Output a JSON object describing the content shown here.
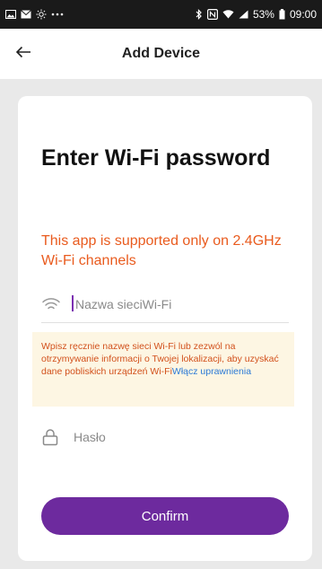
{
  "status_bar": {
    "battery_percent": "53%",
    "time": "09:00",
    "notification_icons": [
      "image-icon",
      "mail-icon",
      "sun-icon",
      "more-icon"
    ],
    "system_icons": [
      "bluetooth-icon",
      "nfc-icon",
      "wifi-icon",
      "signal-icon",
      "battery-icon"
    ]
  },
  "header": {
    "title": "Add Device",
    "back_icon": "arrow-left-icon"
  },
  "card": {
    "heading": "Enter Wi-Fi password",
    "warning": "This app is supported only on 2.4GHz Wi-Fi channels",
    "ssid": {
      "icon": "wifi-icon",
      "placeholder": "Nazwa sieciWi-Fi",
      "value": ""
    },
    "hint": {
      "text": "Wpisz ręcznie nazwę sieci Wi-Fi lub zezwól na otrzymywanie informacji o Twojej lokalizacji, aby uzyskać dane pobliskich urządzeń Wi-Fi",
      "link_text": "Włącz uprawnienia"
    },
    "password": {
      "icon": "lock-icon",
      "placeholder": "Hasło",
      "value": ""
    },
    "confirm_label": "Confirm"
  },
  "colors": {
    "accent": "#6d2a9e",
    "warning": "#e95b1e",
    "hint_background": "#fdf6e3",
    "link": "#2c7ad6",
    "status_bar": "#1a1a1a",
    "page_background": "#e9e9e9"
  }
}
